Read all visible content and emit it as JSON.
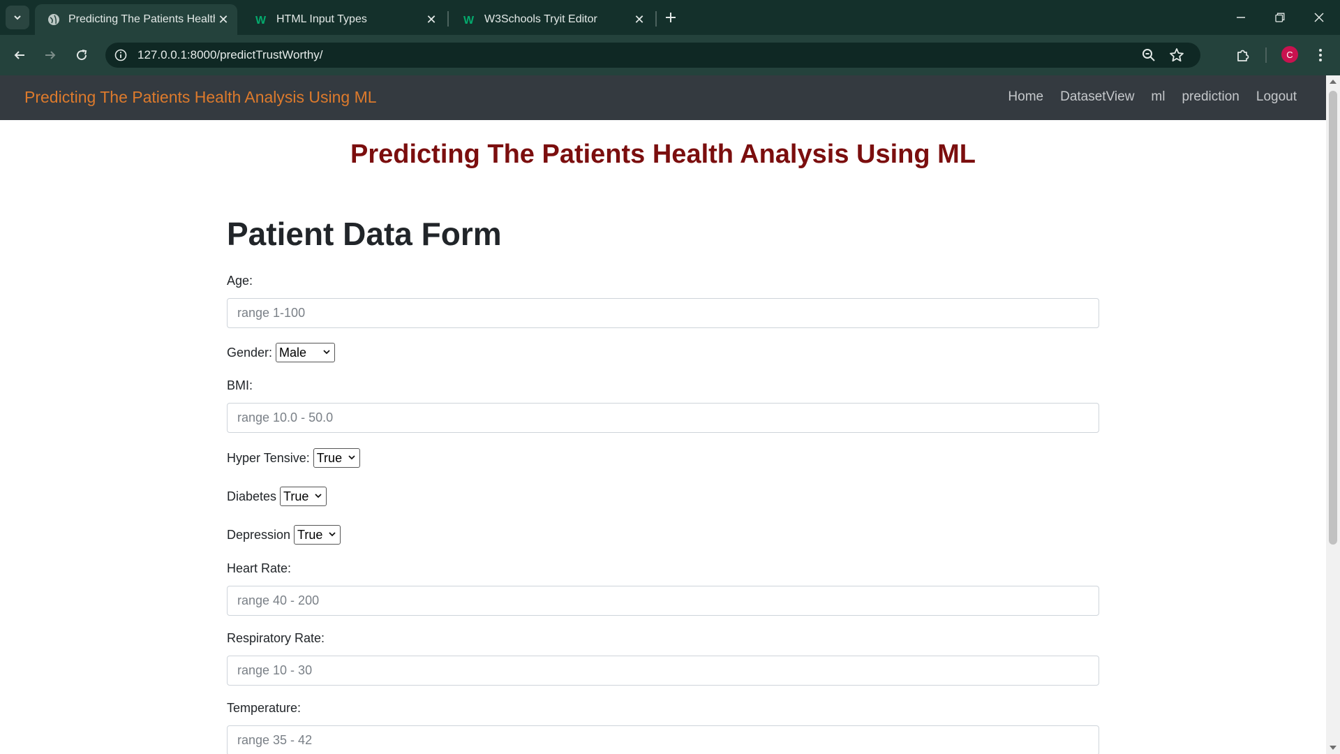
{
  "browser": {
    "tabs": [
      {
        "title": "Predicting The Patients Health A"
      },
      {
        "title": "HTML Input Types"
      },
      {
        "title": "W3Schools Tryit Editor"
      }
    ],
    "url": "127.0.0.1:8000/predictTrustWorthy/",
    "profile_initial": "C",
    "colors": {
      "avatar": "#c8124f",
      "frame": "#14302b",
      "toolbar": "#24423c"
    }
  },
  "app": {
    "brand": "Predicting The Patients Health Analysis Using ML",
    "nav": [
      "Home",
      "DatasetView",
      "ml",
      "prediction",
      "Logout"
    ]
  },
  "page": {
    "heading": "Predicting The Patients Health Analysis Using ML",
    "form_title": "Patient Data Form",
    "fields": {
      "age": {
        "label": "Age:",
        "placeholder": "range 1-100"
      },
      "gender": {
        "label": "Gender:",
        "value": "Male"
      },
      "bmi": {
        "label": "BMI:",
        "placeholder": "range 10.0 - 50.0"
      },
      "hypertensive": {
        "label": "Hyper Tensive:",
        "value": "True"
      },
      "diabetes": {
        "label": "Diabetes",
        "value": "True"
      },
      "depression": {
        "label": "Depression",
        "value": "True"
      },
      "heart_rate": {
        "label": "Heart Rate:",
        "placeholder": "range 40 - 200"
      },
      "respiratory_rate": {
        "label": "Respiratory Rate:",
        "placeholder": "range 10 - 30"
      },
      "temperature": {
        "label": "Temperature:",
        "placeholder": "range 35 - 42"
      }
    },
    "colors": {
      "brand": "#dd7a2c",
      "heading": "#7b0e0e",
      "navbar": "#343a40"
    }
  }
}
